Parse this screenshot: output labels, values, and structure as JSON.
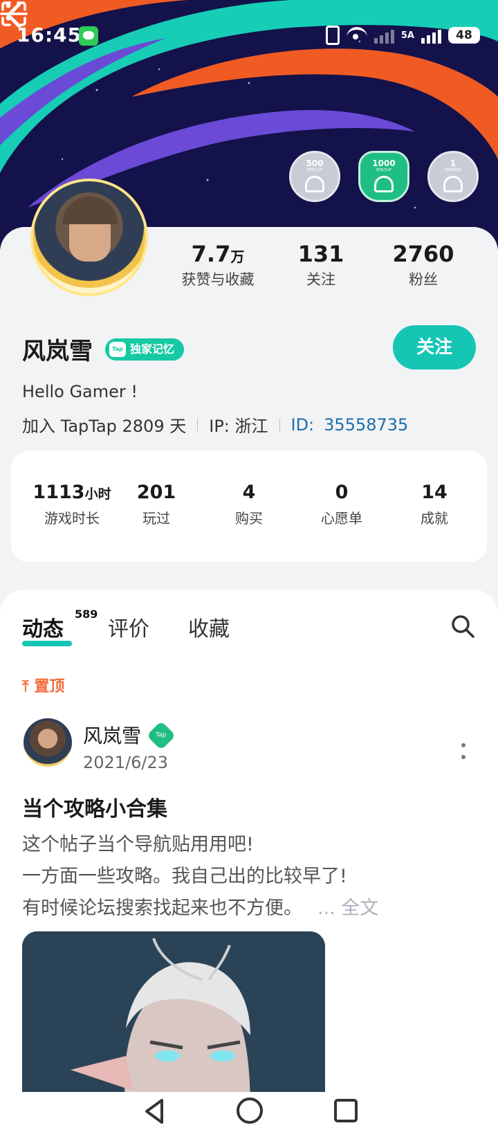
{
  "status_bar": {
    "time": "16:45",
    "network": "5A",
    "battery": "48"
  },
  "header": {
    "badges": [
      {
        "value": "500",
        "caption": "影响力UP",
        "icon": "user-up-icon"
      },
      {
        "value": "1000",
        "caption": "影响力UP",
        "icon": "user-up-icon"
      },
      {
        "value": "1",
        "caption": "游戏探险者",
        "icon": "gamepad-icon"
      }
    ]
  },
  "profile": {
    "stats": [
      {
        "value": "7.7",
        "unit": "万",
        "label": "获赞与收藏"
      },
      {
        "value": "131",
        "unit": "",
        "label": "关注"
      },
      {
        "value": "2760",
        "unit": "",
        "label": "粉丝"
      }
    ],
    "username": "风岚雪",
    "tag": "独家记忆",
    "follow_label": "关注",
    "bio": "Hello Gamer !",
    "join_text": "加入 TapTap 2809 天",
    "ip_text": "IP:  浙江",
    "id_label": "ID:",
    "id_value": "35558735"
  },
  "game_stats": [
    {
      "value": "1113",
      "unit": "小时",
      "label": "游戏时长"
    },
    {
      "value": "201",
      "unit": "",
      "label": "玩过"
    },
    {
      "value": "4",
      "unit": "",
      "label": "购买"
    },
    {
      "value": "0",
      "unit": "",
      "label": "心愿单"
    },
    {
      "value": "14",
      "unit": "",
      "label": "成就"
    }
  ],
  "feed": {
    "tabs": [
      {
        "label": "动态",
        "count": "589",
        "active": true
      },
      {
        "label": "评价",
        "active": false
      },
      {
        "label": "收藏",
        "active": false
      }
    ],
    "pinned_label": "置顶",
    "post": {
      "author": "风岚雪",
      "author_badge": "Tap",
      "date": "2021/6/23",
      "title": "当个攻略小合集",
      "lines": [
        "这个帖子当个导航贴用用吧!",
        "一方面一些攻略。我自己出的比较早了!",
        "有时候论坛搜索找起来也不方便。"
      ],
      "more_label": "... 全文"
    }
  },
  "colors": {
    "accent": "#15c6b5",
    "pinned": "#f26b3a",
    "id_link": "#1b6fa8",
    "banner_bg": "#13124a"
  }
}
